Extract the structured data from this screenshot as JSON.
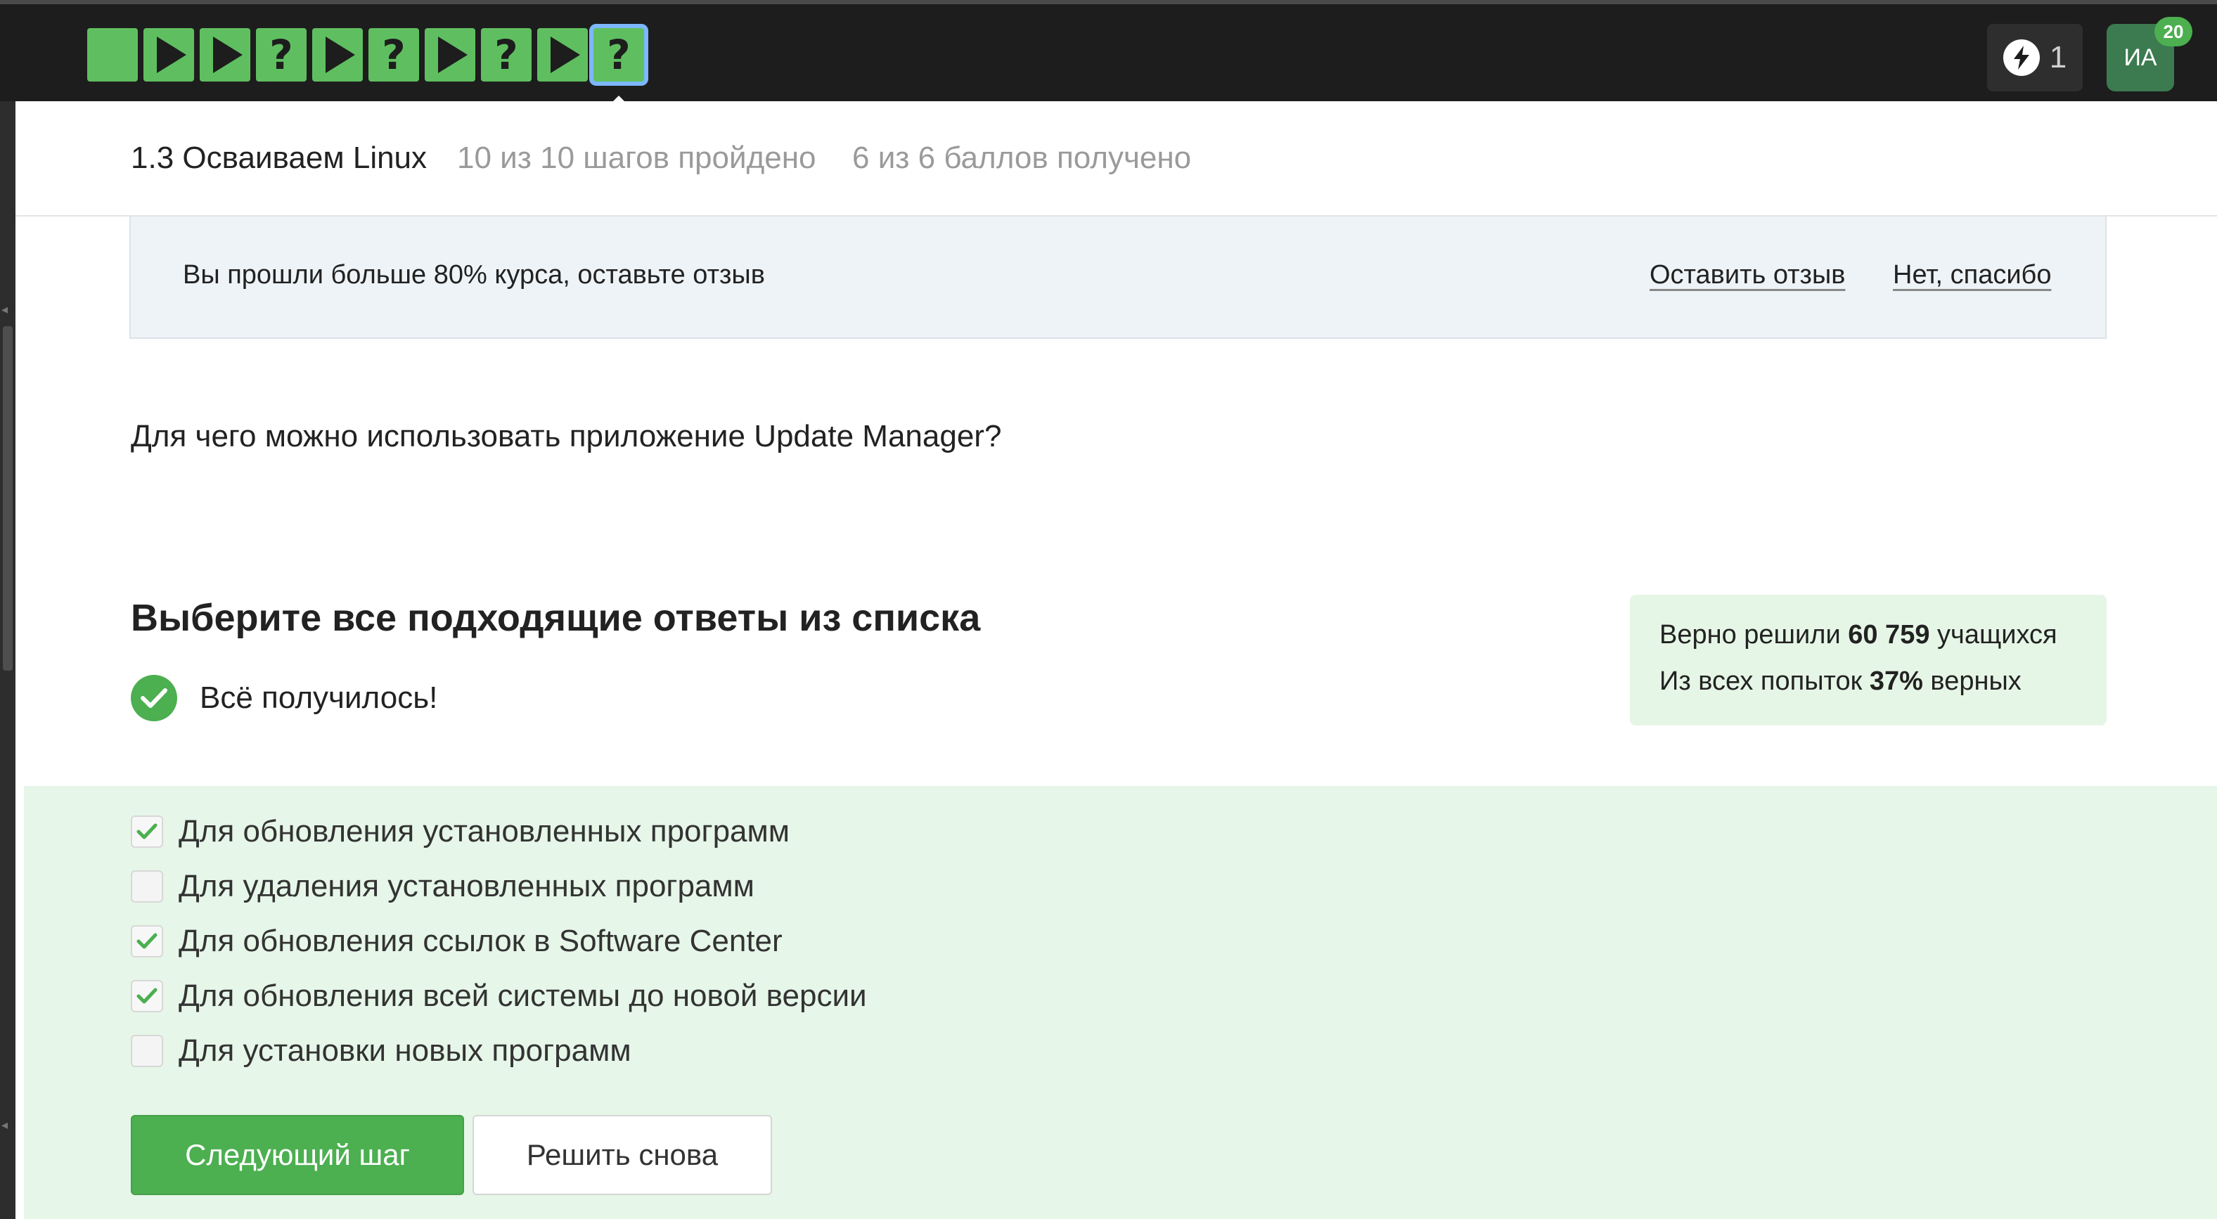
{
  "nav": {
    "steps": [
      {
        "type": "text",
        "symbol": ""
      },
      {
        "type": "video",
        "symbol": ""
      },
      {
        "type": "video",
        "symbol": ""
      },
      {
        "type": "quiz",
        "symbol": "?"
      },
      {
        "type": "video",
        "symbol": ""
      },
      {
        "type": "quiz",
        "symbol": "?"
      },
      {
        "type": "video",
        "symbol": ""
      },
      {
        "type": "quiz",
        "symbol": "?"
      },
      {
        "type": "video",
        "symbol": ""
      },
      {
        "type": "quiz",
        "symbol": "?",
        "current": true
      }
    ],
    "energy_count": "1",
    "avatar_initials": "ИА",
    "notifications_count": "20"
  },
  "lesson": {
    "title": "1.3 Осваиваем Linux",
    "steps_progress": "10 из 10 шагов пройдено",
    "points_progress": "6 из 6 баллов  получено"
  },
  "feedback": {
    "text": "Вы прошли больше 80% курса, оставьте отзыв",
    "leave_label": "Оставить отзыв",
    "decline_label": "Нет, спасибо"
  },
  "question": {
    "text": "Для чего можно использовать приложение Update Manager?",
    "instruction": "Выберите все подходящие ответы из списка",
    "status": "Всё получилось!"
  },
  "stats": {
    "solved_prefix": "Верно решили ",
    "solved_count": "60 759",
    "solved_suffix": " учащихся",
    "attempts_prefix": "Из всех попыток ",
    "attempts_percent": "37%",
    "attempts_suffix": " верных"
  },
  "options": [
    {
      "label": "Для обновления установленных программ",
      "checked": true
    },
    {
      "label": "Для удаления установленных программ",
      "checked": false
    },
    {
      "label": "Для обновления ссылок в Software Center",
      "checked": true
    },
    {
      "label": "Для обновления всей системы до новой версии",
      "checked": true
    },
    {
      "label": "Для установки новых программ",
      "checked": false
    }
  ],
  "actions": {
    "next_label": "Следующий шаг",
    "retry_label": "Решить снова"
  },
  "colors": {
    "accent_green": "#4caf50",
    "step_green": "#5fbf60",
    "topbar": "#1d1d1d",
    "answers_bg": "#e6f6e8"
  }
}
